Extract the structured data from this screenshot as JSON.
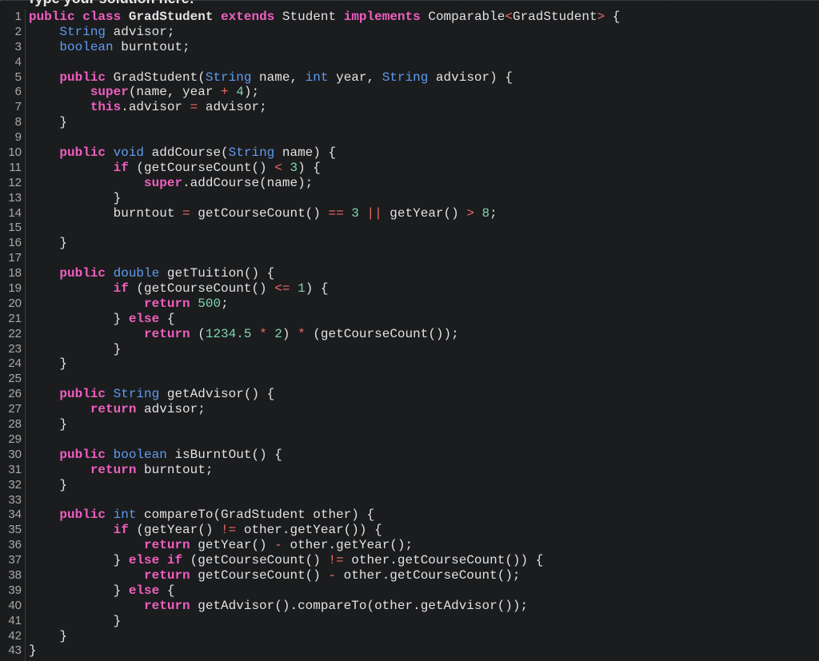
{
  "header": {
    "prompt": "Type your solution here:"
  },
  "editor": {
    "language": "java",
    "colors": {
      "background": "#1b1c1e",
      "keyword": "#ee5fc0",
      "type": "#5e9bf0",
      "number": "#7cd6b3",
      "operator": "#f06a64",
      "text": "#e2e2e2",
      "line_number": "#a8a8a8"
    },
    "lines": [
      [
        [
          "kw",
          "public"
        ],
        [
          "t",
          " "
        ],
        [
          "kw",
          "class"
        ],
        [
          "t",
          " "
        ],
        [
          "cls",
          "GradStudent"
        ],
        [
          "t",
          " "
        ],
        [
          "kw",
          "extends"
        ],
        [
          "t",
          " Student "
        ],
        [
          "kw",
          "implements"
        ],
        [
          "t",
          " Comparable"
        ],
        [
          "op",
          "<"
        ],
        [
          "t",
          "GradStudent"
        ],
        [
          "op",
          ">"
        ],
        [
          "t",
          " {"
        ]
      ],
      [
        [
          "t",
          "    "
        ],
        [
          "ty",
          "String"
        ],
        [
          "t",
          " advisor;"
        ]
      ],
      [
        [
          "t",
          "    "
        ],
        [
          "ty",
          "boolean"
        ],
        [
          "t",
          " burntout;"
        ]
      ],
      [],
      [
        [
          "t",
          "    "
        ],
        [
          "kw",
          "public"
        ],
        [
          "t",
          " GradStudent("
        ],
        [
          "ty",
          "String"
        ],
        [
          "t",
          " name, "
        ],
        [
          "ty",
          "int"
        ],
        [
          "t",
          " year, "
        ],
        [
          "ty",
          "String"
        ],
        [
          "t",
          " advisor) {"
        ]
      ],
      [
        [
          "t",
          "        "
        ],
        [
          "kw",
          "super"
        ],
        [
          "t",
          "(name, year "
        ],
        [
          "op",
          "+"
        ],
        [
          "t",
          " "
        ],
        [
          "num",
          "4"
        ],
        [
          "t",
          ");"
        ]
      ],
      [
        [
          "t",
          "        "
        ],
        [
          "kw",
          "this"
        ],
        [
          "t",
          ".advisor "
        ],
        [
          "op",
          "="
        ],
        [
          "t",
          " advisor;"
        ]
      ],
      [
        [
          "t",
          "    }"
        ]
      ],
      [],
      [
        [
          "t",
          "    "
        ],
        [
          "kw",
          "public"
        ],
        [
          "t",
          " "
        ],
        [
          "ty",
          "void"
        ],
        [
          "t",
          " addCourse("
        ],
        [
          "ty",
          "String"
        ],
        [
          "t",
          " name) {"
        ]
      ],
      [
        [
          "t",
          "           "
        ],
        [
          "kw",
          "if"
        ],
        [
          "t",
          " (getCourseCount() "
        ],
        [
          "op",
          "<"
        ],
        [
          "t",
          " "
        ],
        [
          "num",
          "3"
        ],
        [
          "t",
          ") {"
        ]
      ],
      [
        [
          "t",
          "               "
        ],
        [
          "kw",
          "super"
        ],
        [
          "t",
          ".addCourse(name);"
        ]
      ],
      [
        [
          "t",
          "           }"
        ]
      ],
      [
        [
          "t",
          "           burntout "
        ],
        [
          "op",
          "="
        ],
        [
          "t",
          " getCourseCount() "
        ],
        [
          "op",
          "=="
        ],
        [
          "t",
          " "
        ],
        [
          "num",
          "3"
        ],
        [
          "t",
          " "
        ],
        [
          "op",
          "||"
        ],
        [
          "t",
          " getYear() "
        ],
        [
          "op",
          ">"
        ],
        [
          "t",
          " "
        ],
        [
          "num",
          "8"
        ],
        [
          "t",
          ";"
        ]
      ],
      [],
      [
        [
          "t",
          "    }"
        ]
      ],
      [],
      [
        [
          "t",
          "    "
        ],
        [
          "kw",
          "public"
        ],
        [
          "t",
          " "
        ],
        [
          "ty",
          "double"
        ],
        [
          "t",
          " getTuition() {"
        ]
      ],
      [
        [
          "t",
          "           "
        ],
        [
          "kw",
          "if"
        ],
        [
          "t",
          " (getCourseCount() "
        ],
        [
          "op",
          "<="
        ],
        [
          "t",
          " "
        ],
        [
          "num",
          "1"
        ],
        [
          "t",
          ") {"
        ]
      ],
      [
        [
          "t",
          "               "
        ],
        [
          "kw",
          "return"
        ],
        [
          "t",
          " "
        ],
        [
          "num",
          "500"
        ],
        [
          "t",
          ";"
        ]
      ],
      [
        [
          "t",
          "           } "
        ],
        [
          "kw",
          "else"
        ],
        [
          "t",
          " {"
        ]
      ],
      [
        [
          "t",
          "               "
        ],
        [
          "kw",
          "return"
        ],
        [
          "t",
          " ("
        ],
        [
          "num",
          "1234.5"
        ],
        [
          "t",
          " "
        ],
        [
          "op",
          "*"
        ],
        [
          "t",
          " "
        ],
        [
          "num",
          "2"
        ],
        [
          "t",
          ") "
        ],
        [
          "op",
          "*"
        ],
        [
          "t",
          " (getCourseCount());"
        ]
      ],
      [
        [
          "t",
          "           }"
        ]
      ],
      [
        [
          "t",
          "    }"
        ]
      ],
      [],
      [
        [
          "t",
          "    "
        ],
        [
          "kw",
          "public"
        ],
        [
          "t",
          " "
        ],
        [
          "ty",
          "String"
        ],
        [
          "t",
          " getAdvisor() {"
        ]
      ],
      [
        [
          "t",
          "        "
        ],
        [
          "kw",
          "return"
        ],
        [
          "t",
          " advisor;"
        ]
      ],
      [
        [
          "t",
          "    }"
        ]
      ],
      [],
      [
        [
          "t",
          "    "
        ],
        [
          "kw",
          "public"
        ],
        [
          "t",
          " "
        ],
        [
          "ty",
          "boolean"
        ],
        [
          "t",
          " isBurntOut() {"
        ]
      ],
      [
        [
          "t",
          "        "
        ],
        [
          "kw",
          "return"
        ],
        [
          "t",
          " burntout;"
        ]
      ],
      [
        [
          "t",
          "    }"
        ]
      ],
      [],
      [
        [
          "t",
          "    "
        ],
        [
          "kw",
          "public"
        ],
        [
          "t",
          " "
        ],
        [
          "ty",
          "int"
        ],
        [
          "t",
          " compareTo(GradStudent other) {"
        ]
      ],
      [
        [
          "t",
          "           "
        ],
        [
          "kw",
          "if"
        ],
        [
          "t",
          " (getYear() "
        ],
        [
          "op",
          "!="
        ],
        [
          "t",
          " other.getYear()) {"
        ]
      ],
      [
        [
          "t",
          "               "
        ],
        [
          "kw",
          "return"
        ],
        [
          "t",
          " getYear() "
        ],
        [
          "op",
          "-"
        ],
        [
          "t",
          " other.getYear();"
        ]
      ],
      [
        [
          "t",
          "           } "
        ],
        [
          "kw",
          "else"
        ],
        [
          "t",
          " "
        ],
        [
          "kw",
          "if"
        ],
        [
          "t",
          " (getCourseCount() "
        ],
        [
          "op",
          "!="
        ],
        [
          "t",
          " other.getCourseCount()) {"
        ]
      ],
      [
        [
          "t",
          "               "
        ],
        [
          "kw",
          "return"
        ],
        [
          "t",
          " getCourseCount() "
        ],
        [
          "op",
          "-"
        ],
        [
          "t",
          " other.getCourseCount();"
        ]
      ],
      [
        [
          "t",
          "           } "
        ],
        [
          "kw",
          "else"
        ],
        [
          "t",
          " {"
        ]
      ],
      [
        [
          "t",
          "               "
        ],
        [
          "kw",
          "return"
        ],
        [
          "t",
          " getAdvisor().compareTo(other.getAdvisor());"
        ]
      ],
      [
        [
          "t",
          "           }"
        ]
      ],
      [
        [
          "t",
          "    }"
        ]
      ],
      [
        [
          "t",
          "}"
        ]
      ]
    ]
  }
}
